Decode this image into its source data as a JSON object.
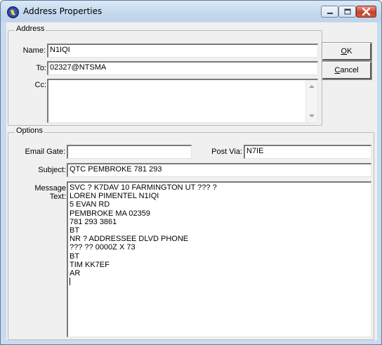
{
  "window": {
    "title": "Address Properties"
  },
  "address": {
    "group_label": "Address",
    "name_label": "Name:",
    "name_value": "N1IQI",
    "to_label": "To:",
    "to_value": "02327@NTSMA",
    "cc_label": "Cc:",
    "cc_value": ""
  },
  "buttons": {
    "ok_accel": "O",
    "ok_rest": "K",
    "cancel_accel": "C",
    "cancel_rest": "ancel"
  },
  "options": {
    "group_label": "Options",
    "email_gate_label": "Email Gate:",
    "email_gate_value": "",
    "post_via_label": "Post Via:",
    "post_via_value": "N7IE",
    "subject_label": "Subject:",
    "subject_value": "QTC PEMBROKE 781 293",
    "message_label_line1": "Message",
    "message_label_line2": "Text:",
    "message_lines": [
      "SVC ? K7DAV 10 FARMINGTON UT ??? ?",
      "LOREN PIMENTEL N1IQI",
      "5 EVAN RD",
      "PEMBROKE MA 02359",
      "781 293 3861",
      "BT",
      "NR ? ADDRESSEE DLVD PHONE",
      "??? ?? 0000Z X 73",
      "BT",
      "TIM KK7EF",
      "AR"
    ]
  },
  "icons": {
    "app": "globe-icon",
    "minimize": "minimize-icon",
    "maximize": "maximize-icon",
    "close": "close-icon",
    "scroll_up": "scroll-up-arrow-icon",
    "scroll_down": "scroll-down-arrow-icon"
  },
  "colors": {
    "titlebar": "#c4d8ee",
    "close_button": "#c6412a",
    "dialog_face": "#f0f0f0"
  }
}
